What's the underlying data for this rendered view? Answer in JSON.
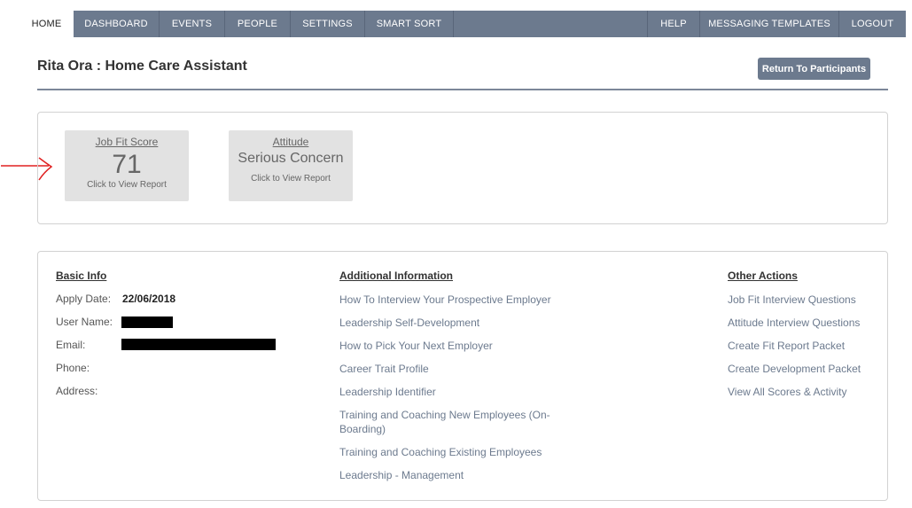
{
  "nav": {
    "home": "HOME",
    "left_items": [
      "DASHBOARD",
      "EVENTS",
      "PEOPLE",
      "SETTINGS",
      "SMART SORT"
    ],
    "right_items": [
      "HELP",
      "MESSAGING TEMPLATES",
      "LOGOUT"
    ]
  },
  "header": {
    "title": "Rita Ora : Home Care Assistant",
    "return_button": "Return To Participants"
  },
  "scores": {
    "job_fit": {
      "title": "Job Fit Score",
      "value": "71",
      "caption": "Click to View Report"
    },
    "attitude": {
      "title": "Attitude",
      "value": "Serious Concern",
      "caption": "Click to View Report"
    }
  },
  "basic_info": {
    "heading": "Basic Info",
    "apply_date_label": "Apply Date:",
    "apply_date": "22/06/2018",
    "user_name_label": "User Name:",
    "email_label": "Email:",
    "phone_label": "Phone:",
    "address_label": "Address:"
  },
  "additional_info": {
    "heading": "Additional Information",
    "links": [
      "How To Interview Your Prospective Employer",
      "Leadership Self-Development",
      "How to Pick Your Next Employer",
      "Career Trait Profile",
      "Leadership Identifier",
      "Training and Coaching New Employees (On-Boarding)",
      "Training and Coaching Existing Employees",
      "Leadership - Management"
    ]
  },
  "other_actions": {
    "heading": "Other Actions",
    "links": [
      "Job Fit Interview Questions",
      "Attitude Interview Questions",
      "Create Fit Report Packet",
      "Create Development Packet",
      "View All Scores & Activity"
    ]
  },
  "colors": {
    "nav_bg": "#6c7a8e",
    "link": "#6c7a8e",
    "card_bg": "#e2e2e2",
    "annotation_arrow": "#e02020"
  }
}
